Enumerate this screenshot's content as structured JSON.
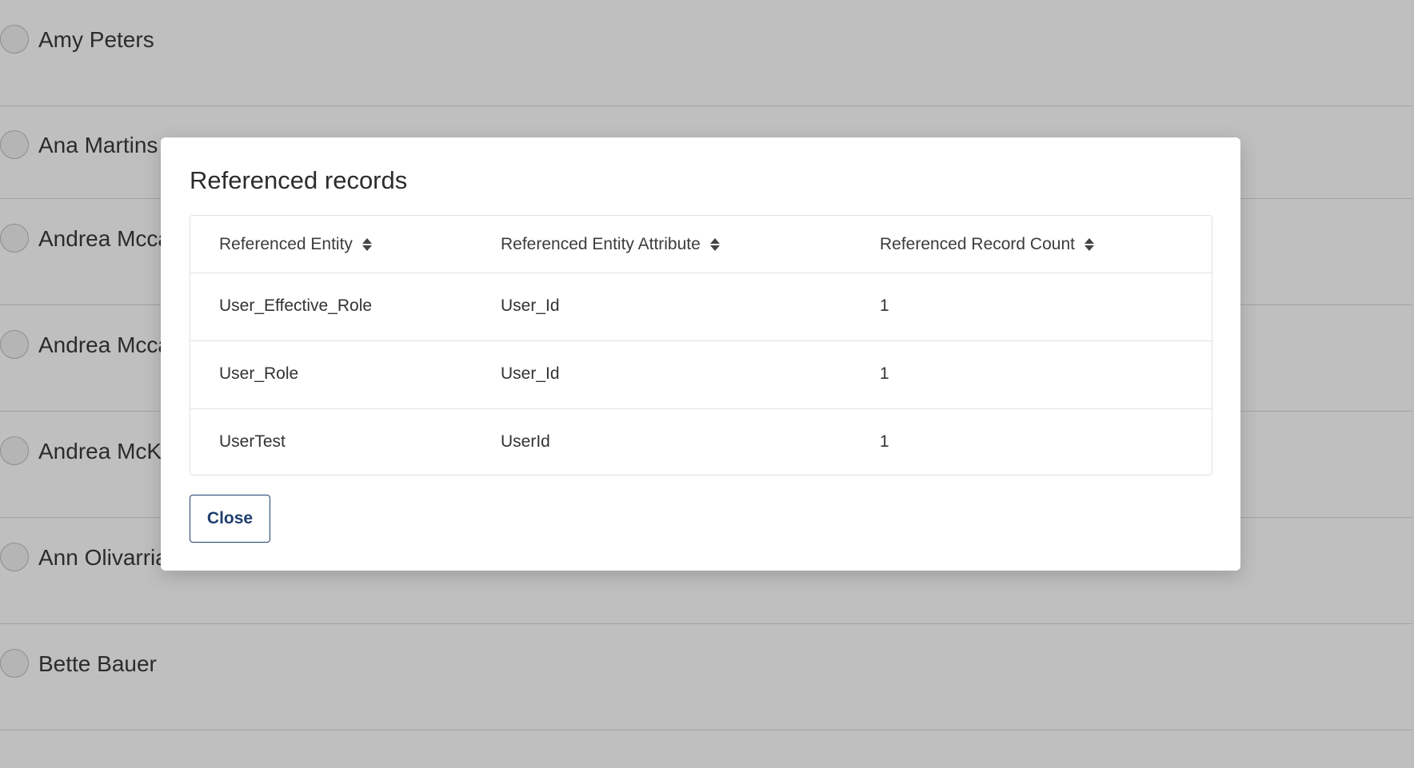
{
  "background_list": {
    "names": [
      "Amy Peters",
      "Ana Martins",
      "Andrea Mcca",
      "Andrea Mcca",
      "Andrea McK",
      "Ann Olivarria",
      "Bette Bauer"
    ]
  },
  "dialog": {
    "title": "Referenced records",
    "columns": [
      "Referenced Entity",
      "Referenced Entity Attribute",
      "Referenced Record Count"
    ],
    "rows": [
      [
        "User_Effective_Role",
        "User_Id",
        "1"
      ],
      [
        "User_Role",
        "User_Id",
        "1"
      ],
      [
        "UserTest",
        "UserId",
        "1"
      ]
    ],
    "close_label": "Close"
  },
  "colors": {
    "accent": "#1f3f6e",
    "scrim": "rgba(0,0,0,0.25)"
  },
  "icons": {
    "sort": "sort-up-down-icon"
  }
}
